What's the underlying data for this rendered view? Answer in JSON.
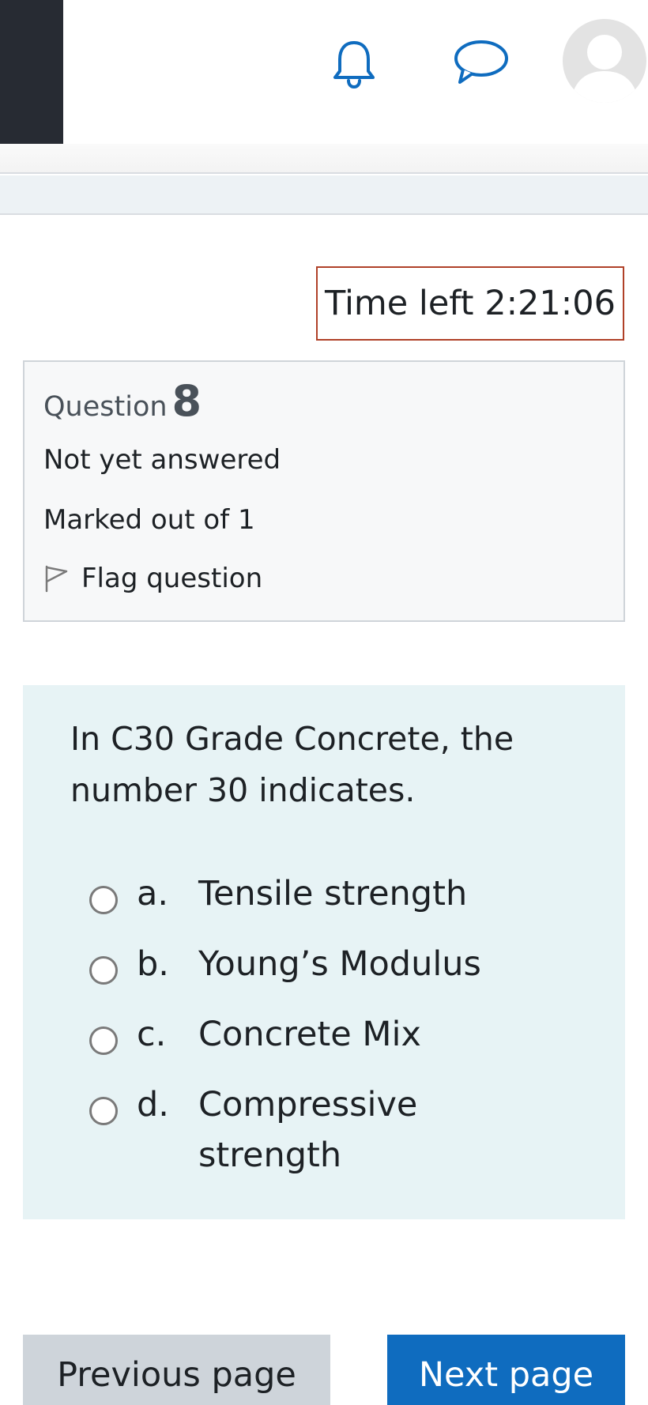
{
  "header": {
    "icons": [
      "bell-icon",
      "chat-icon",
      "user-avatar"
    ],
    "accent_color": "#0f6cbf"
  },
  "timer": {
    "text": "Time left 2:21:06"
  },
  "question_info": {
    "label": "Question",
    "number": "8",
    "state": "Not yet answered",
    "grade": "Marked out of 1",
    "flag_label": "Flag question"
  },
  "question": {
    "text": "In C30 Grade Concrete, the number 30 indicates.",
    "answers": [
      {
        "letter": "a.",
        "text": "Tensile strength"
      },
      {
        "letter": "b.",
        "text": "Young’s Modulus"
      },
      {
        "letter": "c.",
        "text": "Concrete Mix"
      },
      {
        "letter": "d.",
        "text": "Compressive strength"
      }
    ]
  },
  "nav": {
    "prev_label": "Previous page",
    "next_label": "Next page"
  }
}
